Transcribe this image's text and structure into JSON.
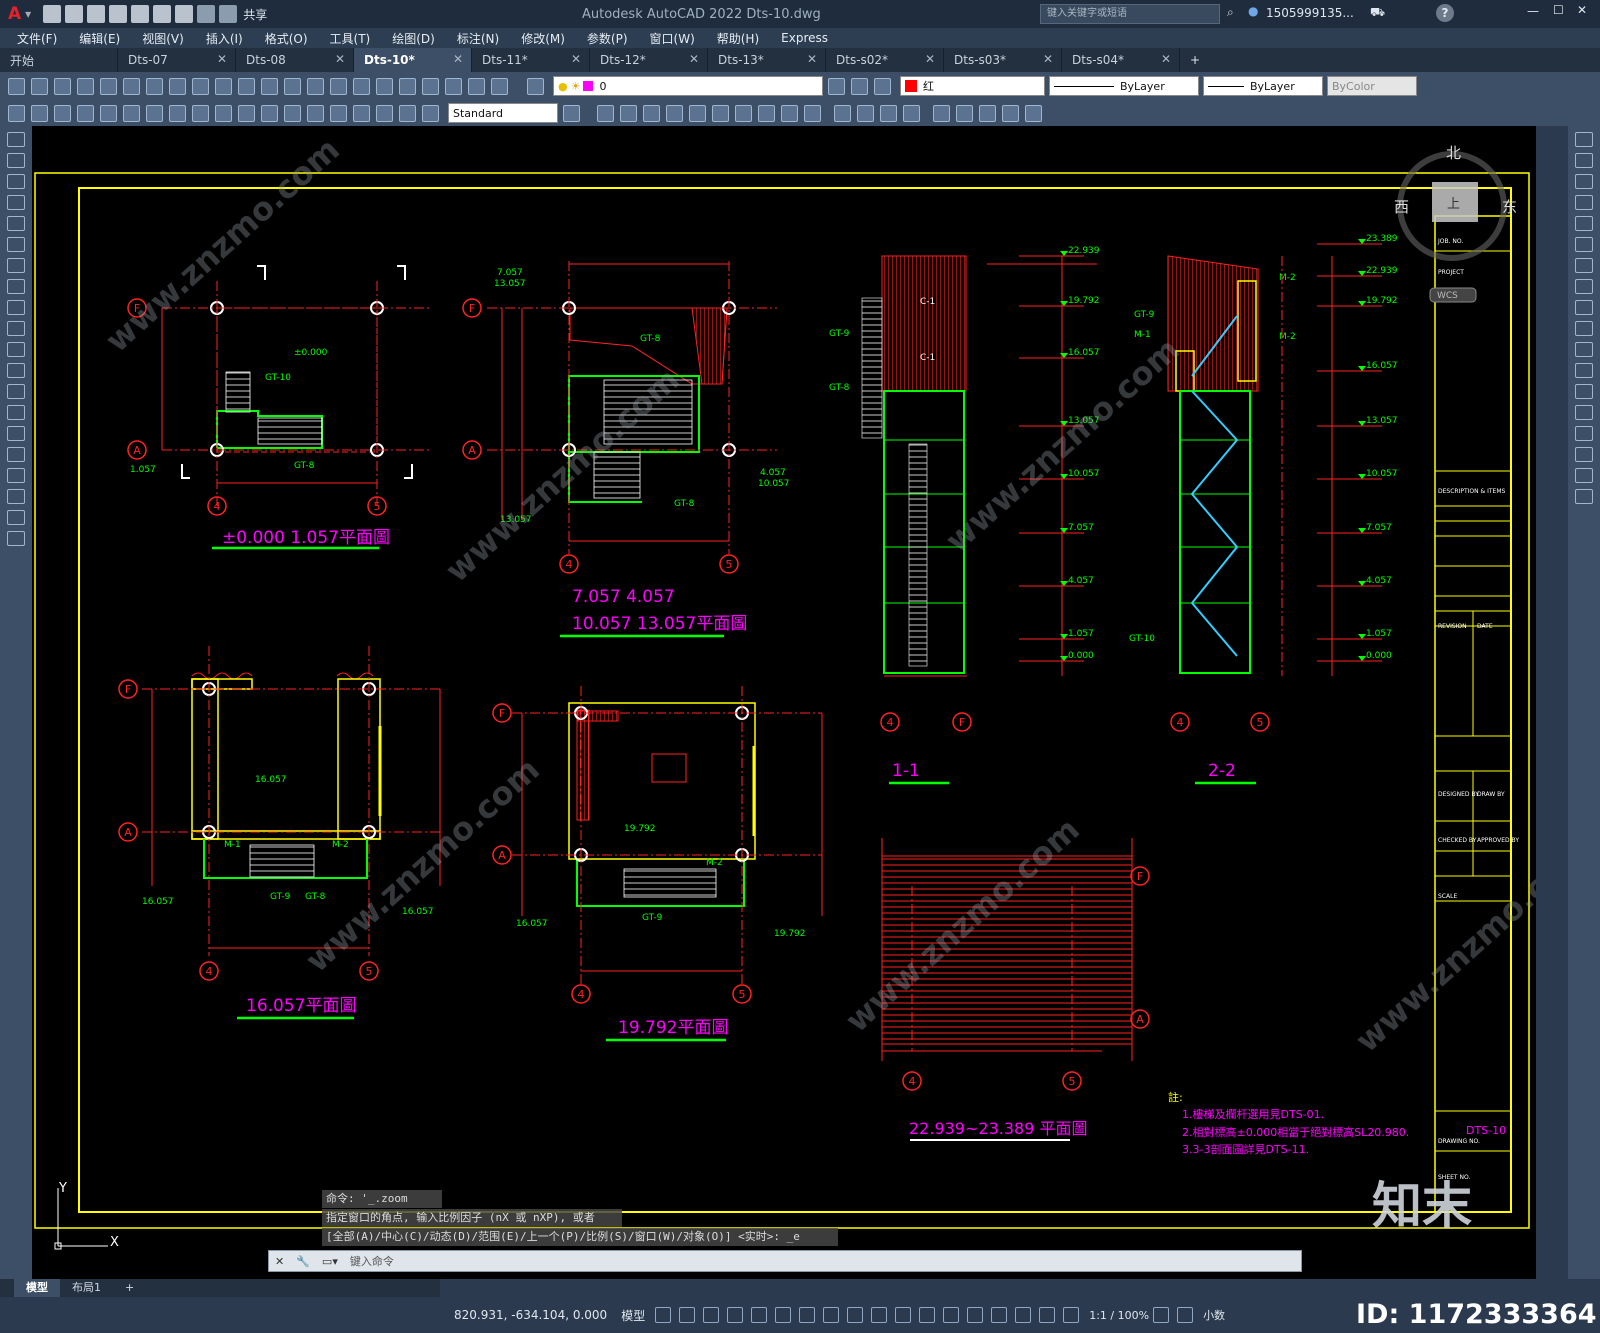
{
  "app": {
    "logo": "A",
    "title": "Autodesk AutoCAD 2022    Dts-10.dwg",
    "search_placeholder": "键入关键字或短语",
    "user": "1505999135...",
    "share": "共享"
  },
  "menu": [
    "文件(F)",
    "编辑(E)",
    "视图(V)",
    "插入(I)",
    "格式(O)",
    "工具(T)",
    "绘图(D)",
    "标注(N)",
    "修改(M)",
    "参数(P)",
    "窗口(W)",
    "帮助(H)",
    "Express"
  ],
  "tabs": [
    {
      "label": "开始"
    },
    {
      "label": "Dts-07"
    },
    {
      "label": "Dts-08"
    },
    {
      "label": "Dts-10*",
      "active": true
    },
    {
      "label": "Dts-11*"
    },
    {
      "label": "Dts-12*"
    },
    {
      "label": "Dts-13*"
    },
    {
      "label": "Dts-s02*"
    },
    {
      "label": "Dts-s03*"
    },
    {
      "label": "Dts-s04*"
    }
  ],
  "toolbar": {
    "layer": "0",
    "color": "红",
    "linetype": "ByLayer",
    "lineweight": "ByLayer",
    "plotstyle": "ByColor",
    "textstyle": "Standard"
  },
  "viewcube": {
    "north": "北",
    "west": "西",
    "east": "东",
    "top": "上",
    "wcs": "WCS"
  },
  "drawing": {
    "plans": [
      {
        "title": "±0.000  1.057平面圖"
      },
      {
        "title_line1": "7.057  4.057",
        "title_line2": "10.057  13.057平面圖"
      },
      {
        "title": "16.057平面圖"
      },
      {
        "title": "19.792平面圖"
      },
      {
        "title": "22.939~23.389 平面圖"
      }
    ],
    "sections": [
      "1-1",
      "2-2"
    ],
    "levels": [
      "23.389",
      "22.939",
      "19.792",
      "16.057",
      "13.057",
      "10.057",
      "7.057",
      "4.057",
      "1.057",
      "0.000"
    ],
    "member_labels": [
      "GT-9",
      "GT-8",
      "GT-10",
      "C-1",
      "M-1",
      "M-2"
    ],
    "grid_axes": [
      "F",
      "A",
      "4",
      "5"
    ],
    "notes_title": "註:",
    "notes": [
      "1.樓梯及欄杆選用見DTS-01.",
      "2.相對標高±0.000相當于絕對標高SL20.980.",
      "3.3-3剖面圖詳見DTS-11."
    ],
    "title_block": {
      "drawing_no": "DTS-10",
      "job_no": "JOB. NO.",
      "project": "PROJECT",
      "description": "DESCRIPTION & ITEMS",
      "revision": "REVISION",
      "date": "DATE",
      "designed": "DESIGNED BY",
      "drawn": "DRAW BY",
      "checked": "CHECKED BY",
      "approved": "APPROVED BY",
      "scale": "SCALE",
      "drawing_no_label": "DRAWING NO.",
      "sheet_no": "SHEET NO."
    }
  },
  "watermark": {
    "site": "www.znzmo.com",
    "brand": "知末",
    "id": "ID: 1172333364"
  },
  "command": {
    "history": [
      "命令: '_.zoom",
      "指定窗口的角点, 输入比例因子 (nX 或 nXP), 或者",
      "[全部(A)/中心(C)/动态(D)/范围(E)/上一个(P)/比例(S)/窗口(W)/对象(O)] <实时>: _e"
    ],
    "placeholder": "键入命令"
  },
  "layout_tabs": [
    {
      "label": "模型",
      "active": true
    },
    {
      "label": "布局1"
    }
  ],
  "status": {
    "coords": "820.931, -634.104, 0.000",
    "mode": "模型",
    "scale": "1:1 / 100%",
    "units": "小数"
  }
}
